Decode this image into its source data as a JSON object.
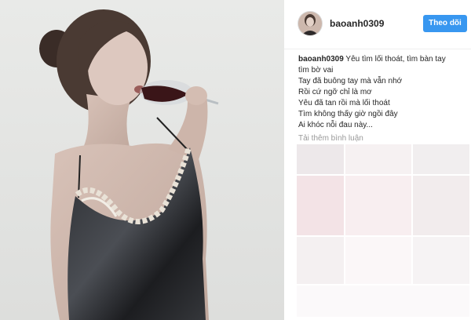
{
  "post": {
    "username": "baoanh0309",
    "follow_label": "Theo dõi"
  },
  "caption": {
    "owner": "baoanh0309",
    "lines": [
      " Yêu tìm lối thoát, tìm bàn tay",
      "tìm bờ vai",
      "Tay đã buông tay mà vẫn nhớ",
      "Rồi cứ ngỡ chỉ là mơ",
      "Yêu đã tan rồi mà lối thoát",
      "Tìm không thấy giờ ngồi đây",
      "Ai khóc nỗi đau này..."
    ]
  },
  "comments": {
    "load_more_label": "Tải thêm bình luận"
  },
  "colors": {
    "follow_button": "#3897f0",
    "text": "#262626",
    "muted": "#999999"
  },
  "icons": {
    "avatar": "profile-photo"
  }
}
